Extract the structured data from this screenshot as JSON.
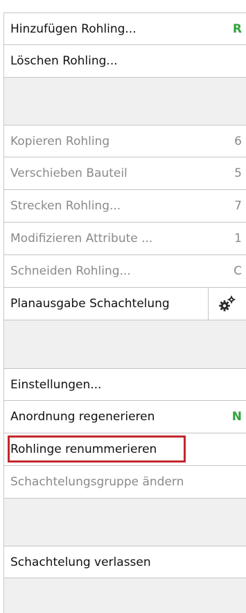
{
  "menu": {
    "items": [
      {
        "label": "Hinzufügen Rohling...",
        "shortcut": "R"
      },
      {
        "label": "Löschen Rohling...",
        "shortcut": ""
      },
      {
        "label": "Kopieren Rohling",
        "shortcut": "6"
      },
      {
        "label": "Verschieben Bauteil",
        "shortcut": "5"
      },
      {
        "label": "Strecken Rohling...",
        "shortcut": "7"
      },
      {
        "label": "Modifizieren Attribute ...",
        "shortcut": "1"
      },
      {
        "label": "Schneiden Rohling...",
        "shortcut": "C"
      },
      {
        "label": "Planausgabe Schachtelung",
        "icon": "gears-icon"
      },
      {
        "label": "Einstellungen...",
        "shortcut": ""
      },
      {
        "label": "Anordnung regenerieren",
        "shortcut": "N"
      },
      {
        "label": "Rohlinge renummerieren",
        "shortcut": "",
        "highlighted": true
      },
      {
        "label": "Schachtelungsgruppe ändern",
        "shortcut": ""
      },
      {
        "label": "Schachtelung verlassen",
        "shortcut": ""
      }
    ]
  },
  "colors": {
    "shortcut_active": "#2fa33a",
    "disabled_text": "#8a8a8a",
    "highlight_border": "#c1272d"
  }
}
